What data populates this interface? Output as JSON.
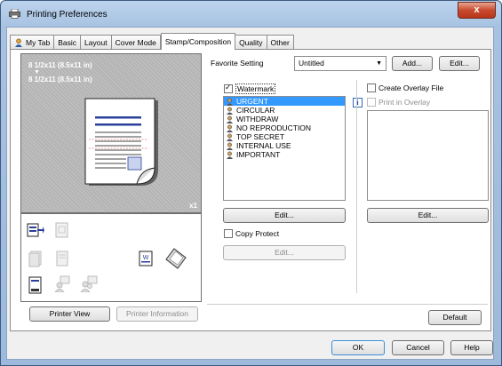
{
  "window": {
    "title": "Printing Preferences",
    "close_glyph": "x"
  },
  "tabs": [
    {
      "label": "My Tab",
      "icon": "favorite-icon"
    },
    {
      "label": "Basic"
    },
    {
      "label": "Layout"
    },
    {
      "label": "Cover Mode"
    },
    {
      "label": "Stamp/Composition",
      "active": true
    },
    {
      "label": "Quality"
    },
    {
      "label": "Other"
    }
  ],
  "preview": {
    "paper_label_top": "8 1/2x11 (8.5x11 in)",
    "paper_label_bottom": "8 1/2x11 (8.5x11 in)",
    "page_count": "x1"
  },
  "left_buttons": {
    "printer_view": "Printer View",
    "printer_information": "Printer Information"
  },
  "favorite": {
    "label": "Favorite Setting",
    "value": "Untitled",
    "add": "Add...",
    "edit": "Edit..."
  },
  "watermark": {
    "label": "Watermark",
    "checked": true,
    "items": [
      "URGENT",
      "CIRCULAR",
      "WITHDRAW",
      "NO REPRODUCTION",
      "TOP SECRET",
      "INTERNAL USE",
      "IMPORTANT"
    ],
    "selected_index": 0,
    "edit": "Edit..."
  },
  "copy_protect": {
    "label": "Copy Protect",
    "checked": false,
    "edit": "Edit..."
  },
  "overlay": {
    "create_label": "Create Overlay File",
    "print_label": "Print in Overlay",
    "edit": "Edit..."
  },
  "buttons": {
    "default": "Default",
    "ok": "OK",
    "cancel": "Cancel",
    "help": "Help"
  },
  "colors": {
    "selection": "#3399ff",
    "titlebar": "#a7c2e2",
    "close": "#c84a2e"
  }
}
